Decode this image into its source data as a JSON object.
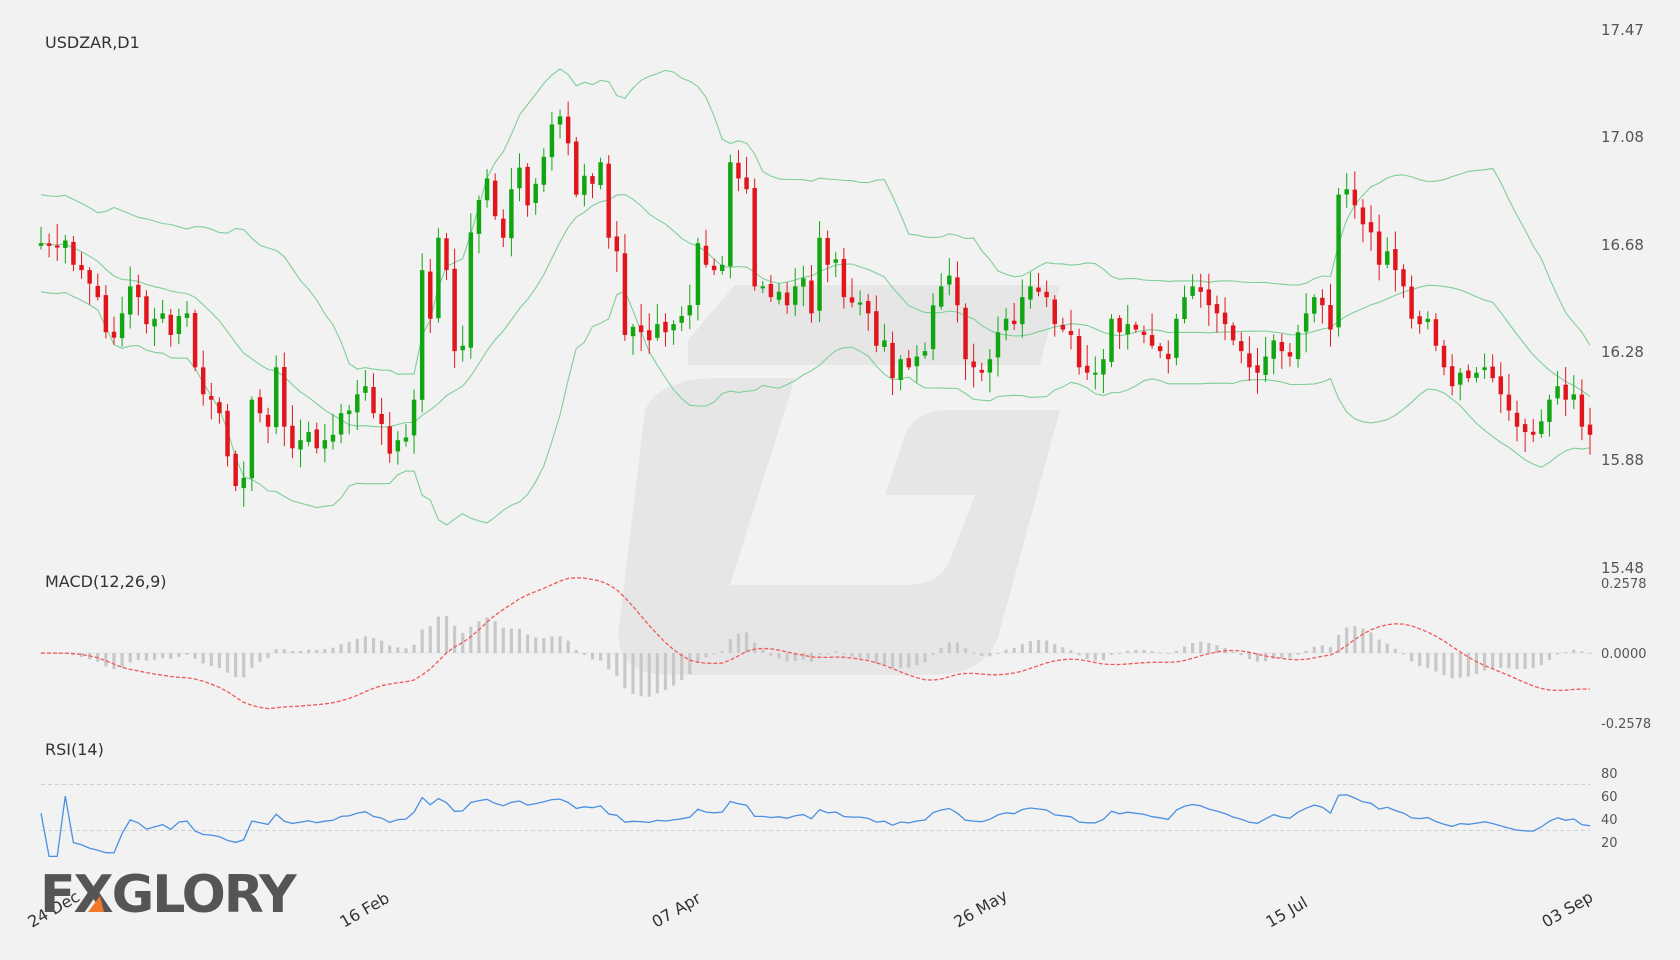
{
  "colors": {
    "up": "#11a611",
    "down": "#e0161c",
    "bands": "#7fcf98",
    "macd_signal": "#ef5a5a",
    "macd_hist": "#c8c8c8",
    "rsi": "#4a90e2",
    "watermark": "#e2e2e2",
    "logo_text": "#555555",
    "logo_accent": "#f07a2a"
  },
  "logo": {
    "text": "FXGLORY"
  },
  "chart_data": [
    {
      "type": "candlestick",
      "title": "USDZAR,D1",
      "ylim": [
        15.48,
        17.47
      ],
      "yticks": [
        "17.47",
        "17.08",
        "16.68",
        "16.28",
        "15.88",
        "15.48"
      ],
      "xticks": [
        "24 Dec",
        "16 Feb",
        "07 Apr",
        "26 May",
        "15 Jul",
        "03 Sep"
      ],
      "xtick_positions": [
        0,
        40,
        80,
        120,
        160,
        200
      ],
      "x_count": 201,
      "closes": [
        16.68,
        16.67,
        16.67,
        16.69,
        16.6,
        16.58,
        16.53,
        16.48,
        16.35,
        16.33,
        16.42,
        16.52,
        16.48,
        16.38,
        16.4,
        16.42,
        16.34,
        16.41,
        16.42,
        16.22,
        16.12,
        16.1,
        16.05,
        15.89,
        15.78,
        15.81,
        16.1,
        16.05,
        16.0,
        16.22,
        16.0,
        15.92,
        15.95,
        15.98,
        15.92,
        15.95,
        15.97,
        16.05,
        16.06,
        16.12,
        16.15,
        16.05,
        16.01,
        15.9,
        15.95,
        15.96,
        16.1,
        16.58,
        16.4,
        16.7,
        16.58,
        16.28,
        16.3,
        16.72,
        16.84,
        16.92,
        16.78,
        16.7,
        16.88,
        16.96,
        16.82,
        16.9,
        17.0,
        17.12,
        17.15,
        17.05,
        16.86,
        16.93,
        16.9,
        16.98,
        16.7,
        16.65,
        16.34,
        16.37,
        16.35,
        16.32,
        16.38,
        16.35,
        16.38,
        16.41,
        16.45,
        16.68,
        16.6,
        16.58,
        16.6,
        16.98,
        16.92,
        16.88,
        16.52,
        16.52,
        16.48,
        16.5,
        16.45,
        16.52,
        16.55,
        16.42,
        16.7,
        16.6,
        16.62,
        16.48,
        16.46,
        16.46,
        16.42,
        16.3,
        16.32,
        16.18,
        16.25,
        16.22,
        16.26,
        16.28,
        16.45,
        16.52,
        16.56,
        16.45,
        16.25,
        16.22,
        16.2,
        16.25,
        16.35,
        16.4,
        16.38,
        16.48,
        16.52,
        16.5,
        16.48,
        16.38,
        16.36,
        16.34,
        16.22,
        16.2,
        16.2,
        16.25,
        16.4,
        16.35,
        16.38,
        16.36,
        16.34,
        16.3,
        16.28,
        16.25,
        16.4,
        16.48,
        16.52,
        16.5,
        16.45,
        16.42,
        16.38,
        16.32,
        16.28,
        16.22,
        16.2,
        16.26,
        16.32,
        16.28,
        16.26,
        16.35,
        16.42,
        16.48,
        16.45,
        16.36,
        16.86,
        16.88,
        16.82,
        16.75,
        16.72,
        16.6,
        16.65,
        16.58,
        16.52,
        16.4,
        16.38,
        16.4,
        16.3,
        16.22,
        16.15,
        16.2,
        16.18,
        16.2,
        16.22,
        16.18,
        16.12,
        16.06,
        16.0,
        15.98,
        15.97,
        16.02,
        16.1,
        16.15,
        16.1,
        16.12,
        16.0,
        15.97
      ],
      "indicators": [
        "Bollinger Bands"
      ]
    },
    {
      "type": "line",
      "title": "MACD(12,26,9)",
      "ylim": [
        -0.2578,
        0.2578
      ],
      "yticks": [
        "0.2578",
        "0.0000",
        "-0.2578"
      ]
    },
    {
      "type": "line",
      "title": "RSI(14)",
      "ylim": [
        0,
        100
      ],
      "yticks": [
        "80",
        "60",
        "40",
        "20"
      ],
      "reference_lines": [
        70,
        30
      ]
    }
  ]
}
